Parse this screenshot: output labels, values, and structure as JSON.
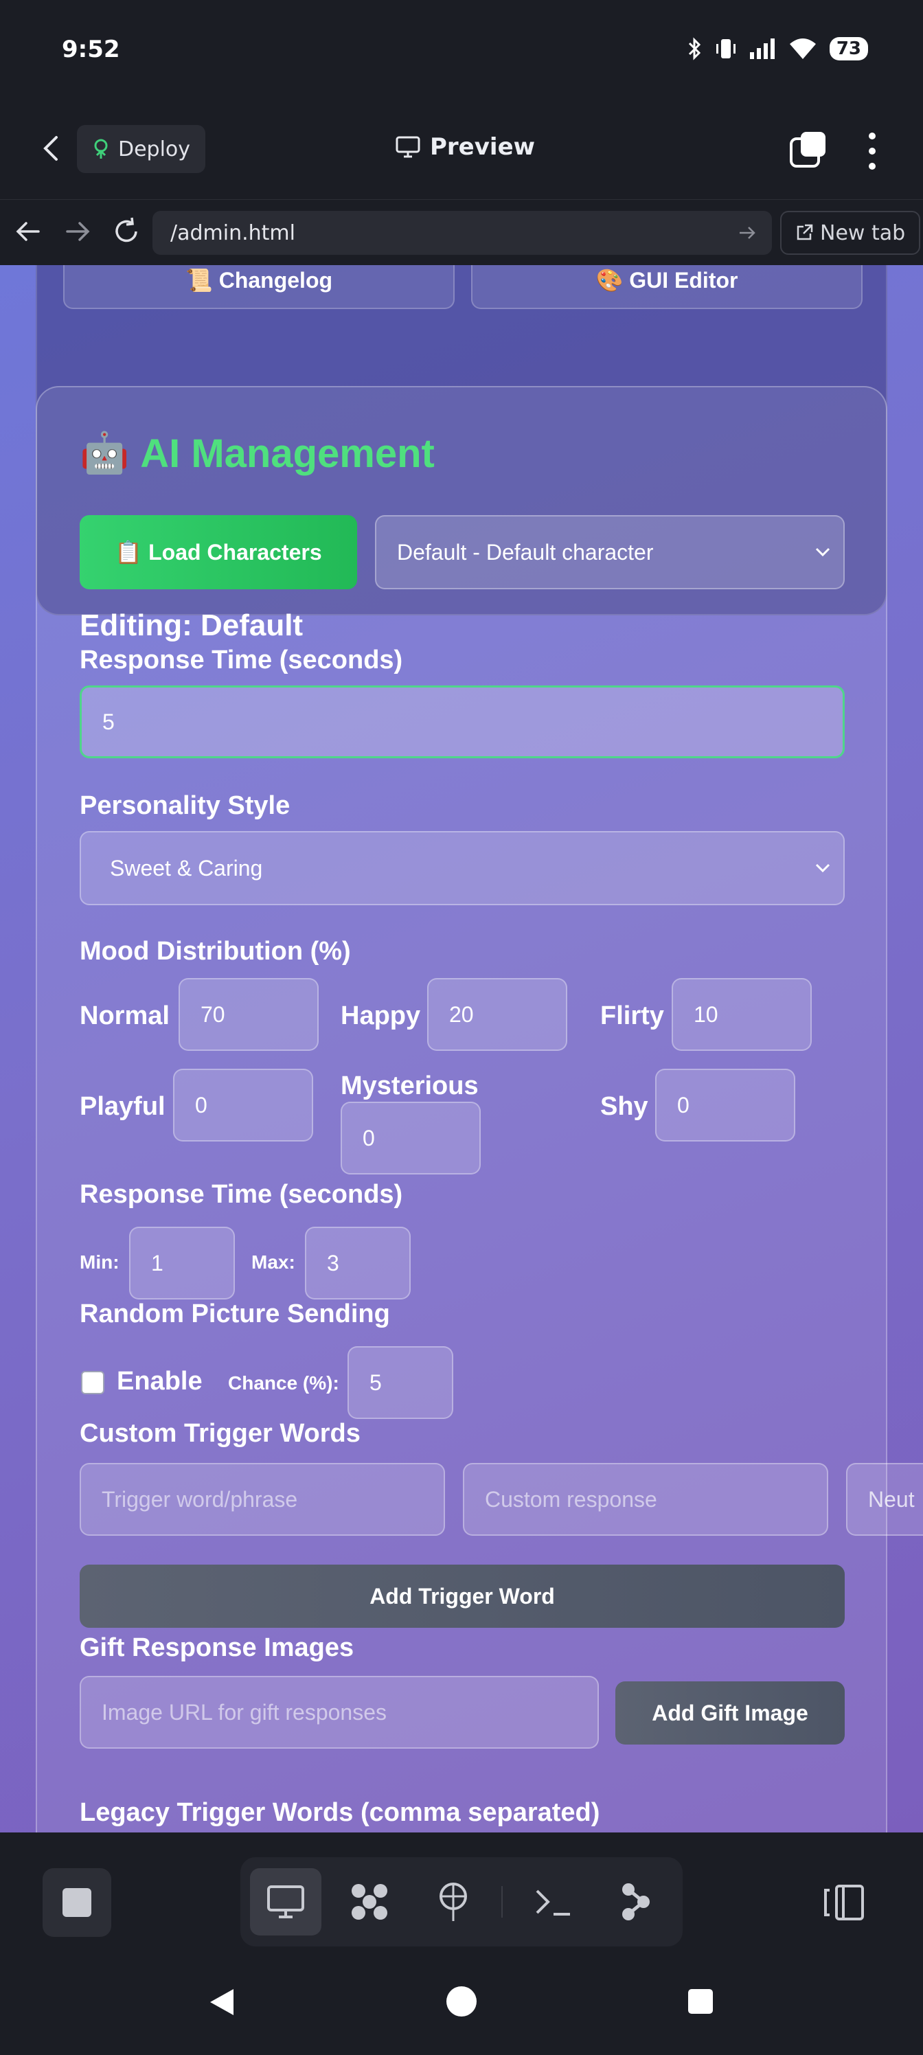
{
  "status_bar": {
    "time": "9:52",
    "battery": "73"
  },
  "app_header": {
    "deploy_label": "Deploy",
    "title": "Preview"
  },
  "url_bar": {
    "url": "/admin.html",
    "new_tab_label": "New tab"
  },
  "top_buttons": {
    "changelog": "📜 Changelog",
    "gui_editor": "🎨 GUI Editor"
  },
  "ai_management": {
    "heading_icon": "🤖",
    "heading": "AI Management",
    "load_button": "📋 Load Characters",
    "character_select": "Default - Default character",
    "editing_label": "Editing: Default",
    "response_time_label": "Response Time (seconds)",
    "response_time_value": "5",
    "personality_label": "Personality Style",
    "personality_value": "Sweet & Caring",
    "mood_label": "Mood Distribution (%)",
    "moods": [
      {
        "label": "Normal",
        "value": "70"
      },
      {
        "label": "Happy",
        "value": "20"
      },
      {
        "label": "Flirty",
        "value": "10"
      },
      {
        "label": "Playful",
        "value": "0"
      },
      {
        "label": "Mysterious",
        "value": "0"
      },
      {
        "label": "Shy",
        "value": "0"
      }
    ],
    "response_range_label": "Response Time (seconds)",
    "min_label": "Min:",
    "min_value": "1",
    "max_label": "Max:",
    "max_value": "3",
    "random_picture_label": "Random Picture Sending",
    "enable_label": "Enable",
    "chance_label": "Chance (%):",
    "chance_value": "5",
    "trigger_label": "Custom Trigger Words",
    "trigger_placeholder": "Trigger word/phrase",
    "response_placeholder": "Custom response",
    "mood_select_partial": "Neut",
    "add_trigger_button": "Add Trigger Word",
    "gift_label": "Gift Response Images",
    "gift_placeholder": "Image URL for gift responses",
    "add_gift_button": "Add Gift Image",
    "legacy_label": "Legacy Trigger Words (comma separated)"
  },
  "colors": {
    "accent_green": "#4fe07e",
    "page_bg": "#1b1d24",
    "gradient_start": "#6f77d8",
    "gradient_end": "#7b5fbd"
  }
}
